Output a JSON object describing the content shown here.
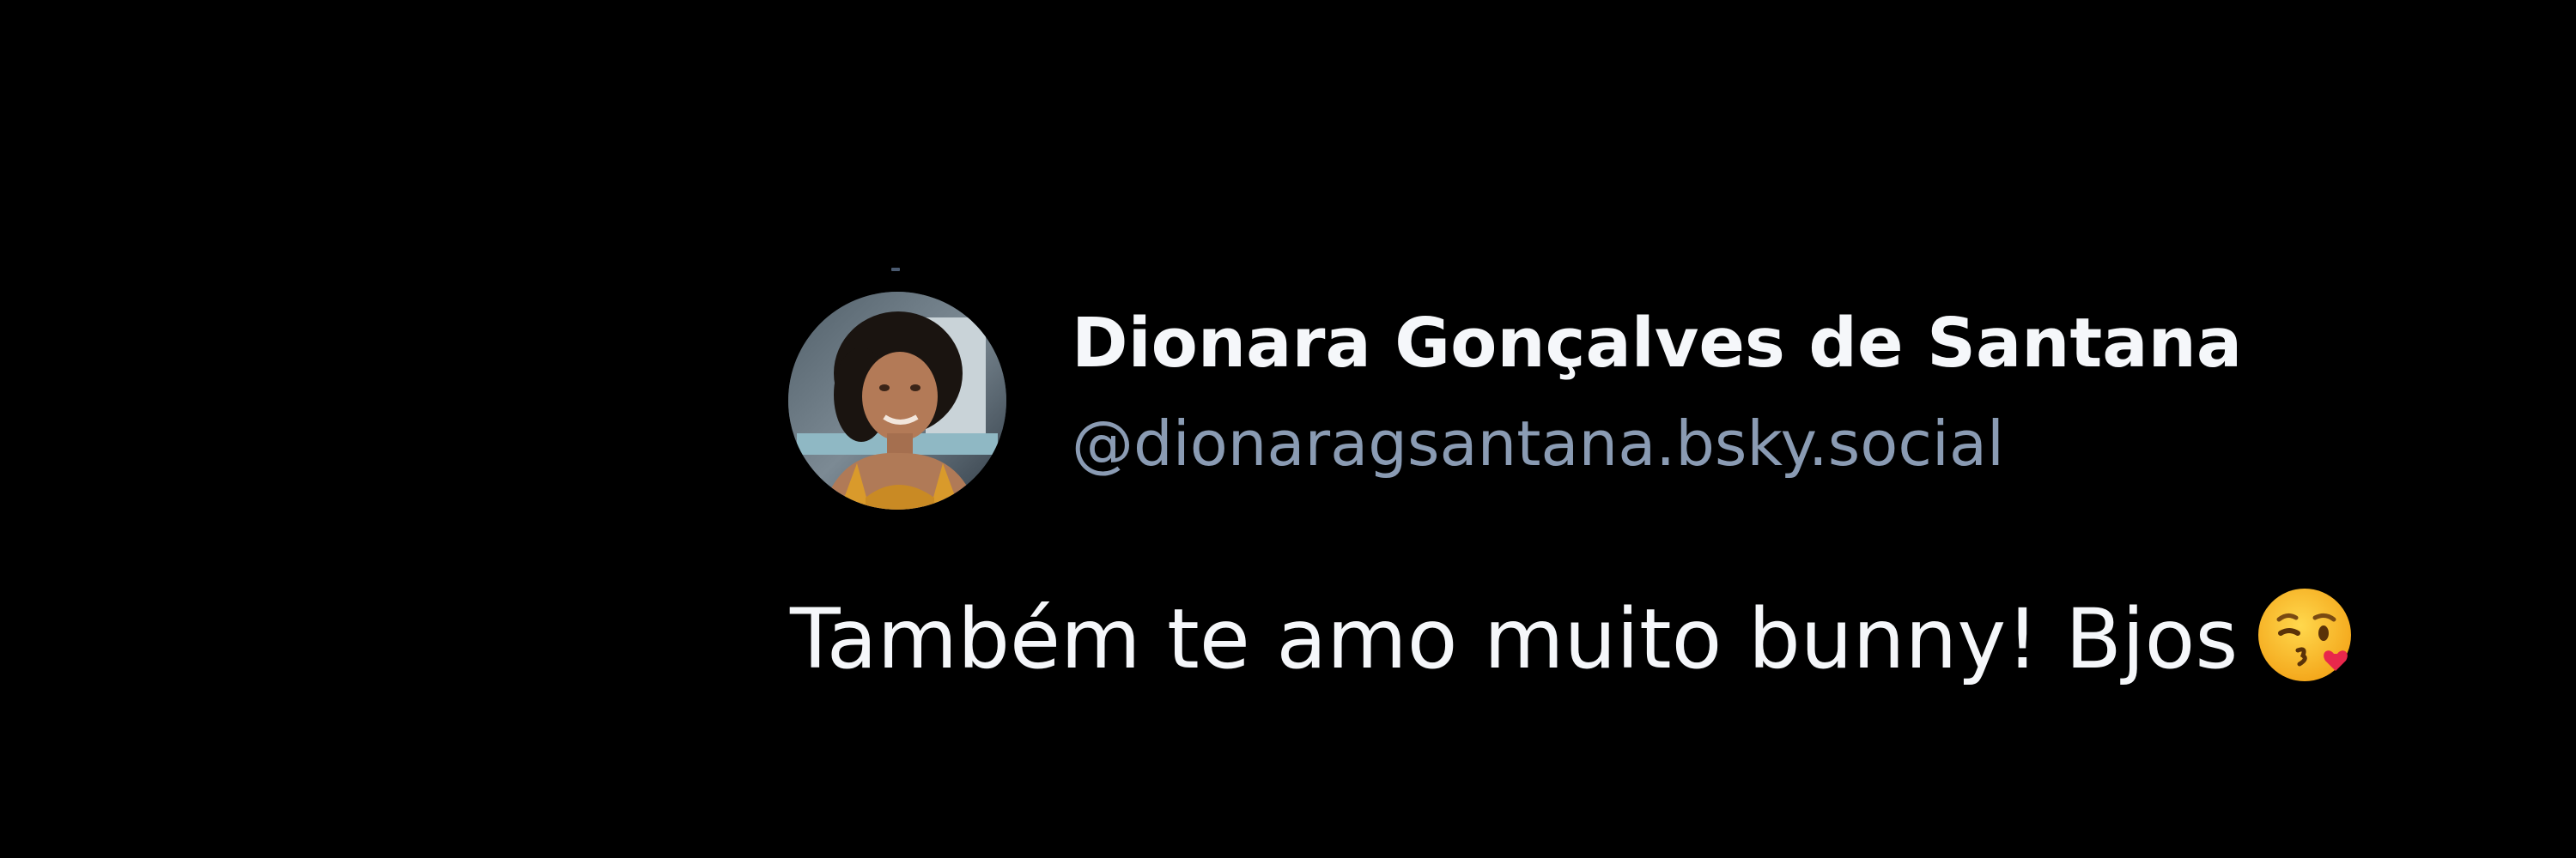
{
  "post": {
    "author": {
      "display_name": "Dionara Gonçalves de Santana",
      "handle": "@dionaragsantana.bsky.social",
      "avatar": "profile-photo"
    },
    "text": "Também te amo muito bunny! Bjos",
    "emoji": "face-blowing-a-kiss-icon"
  },
  "colors": {
    "background": "#000000",
    "primary_text": "#f5f7fa",
    "handle_text": "#8a9bb3"
  }
}
